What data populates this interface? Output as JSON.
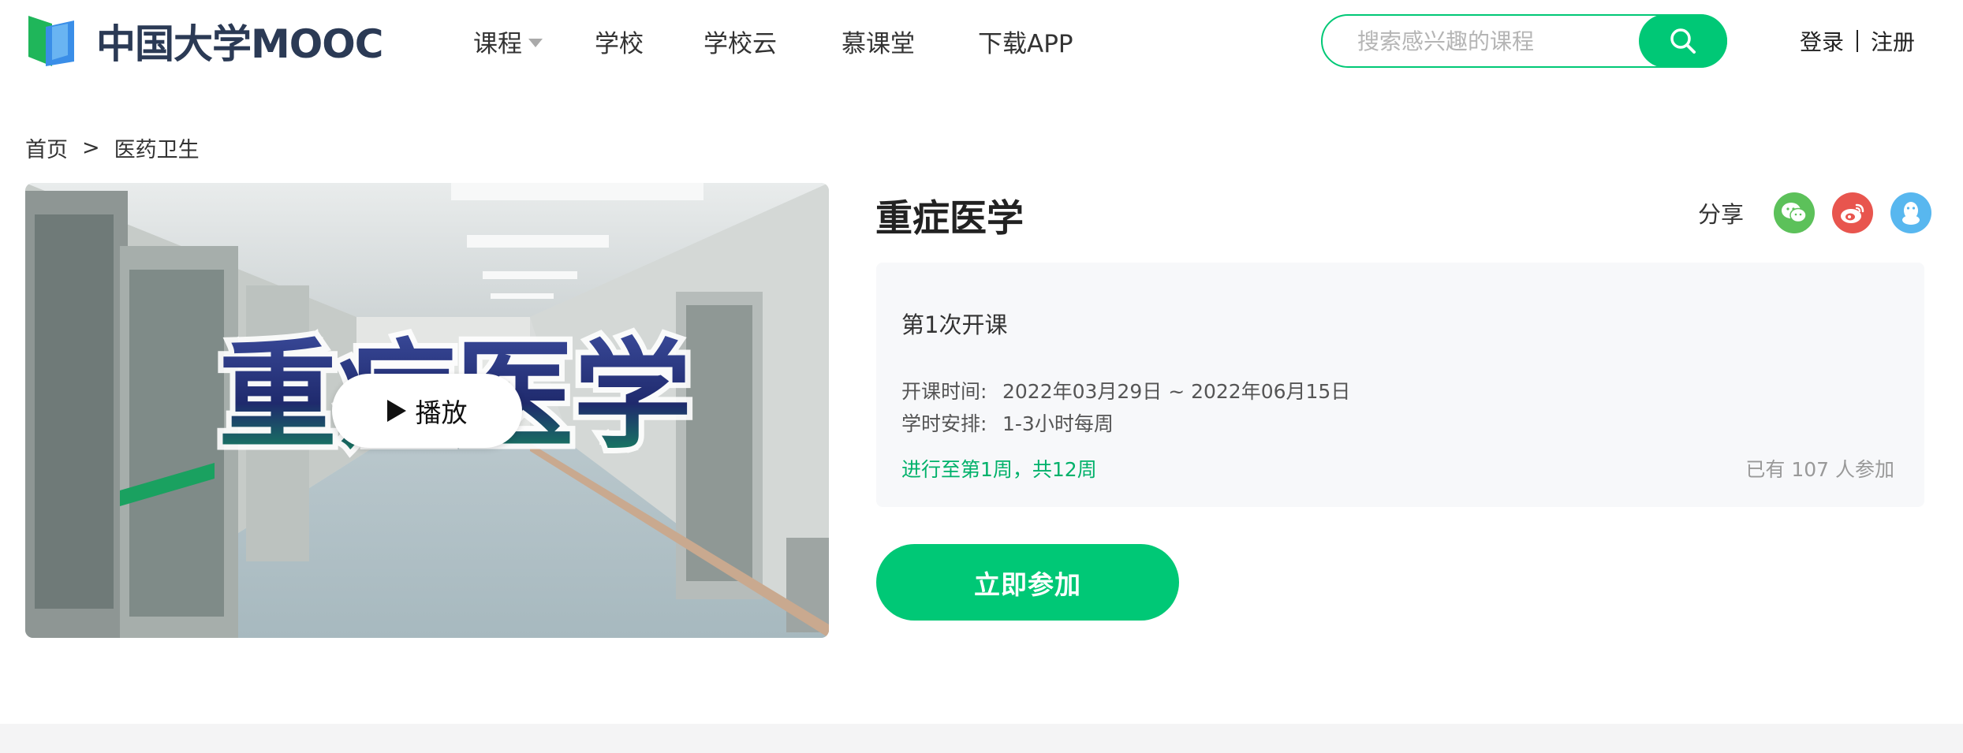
{
  "header": {
    "logo_text": "中国大学MOOC",
    "nav": [
      {
        "label": "课程",
        "has_dropdown": true
      },
      {
        "label": "学校",
        "has_dropdown": false
      },
      {
        "label": "学校云",
        "has_dropdown": false
      },
      {
        "label": "慕课堂",
        "has_dropdown": false
      },
      {
        "label": "下载APP",
        "has_dropdown": false
      }
    ],
    "search": {
      "placeholder": "搜索感兴趣的课程",
      "value": "",
      "icon": "search-icon"
    },
    "auth": {
      "login": "登录",
      "register": "注册"
    }
  },
  "breadcrumb": {
    "home": "首页",
    "separator": ">",
    "category": "医药卫生"
  },
  "cover": {
    "play_label": "播放",
    "icon": "play-icon"
  },
  "course": {
    "title": "重症医学",
    "share_label": "分享",
    "share_icons": [
      "wechat-icon",
      "weibo-icon",
      "qq-icon"
    ],
    "term": "第1次开课",
    "start_label": "开课时间:",
    "start_value": "2022年03月29日 ~ 2022年06月15日",
    "hours_label": "学时安排:",
    "hours_value": "1-3小时每周",
    "progress": "进行至第1周，共12周",
    "joined": "已有 107 人参加",
    "join_button": "立即参加"
  },
  "colors": {
    "brand_green": "#00c876",
    "progress_green": "#00b16a",
    "wechat": "#5cc15a",
    "weibo": "#e8554e",
    "qq": "#58b7ef",
    "info_bg": "#f7f8fa"
  }
}
